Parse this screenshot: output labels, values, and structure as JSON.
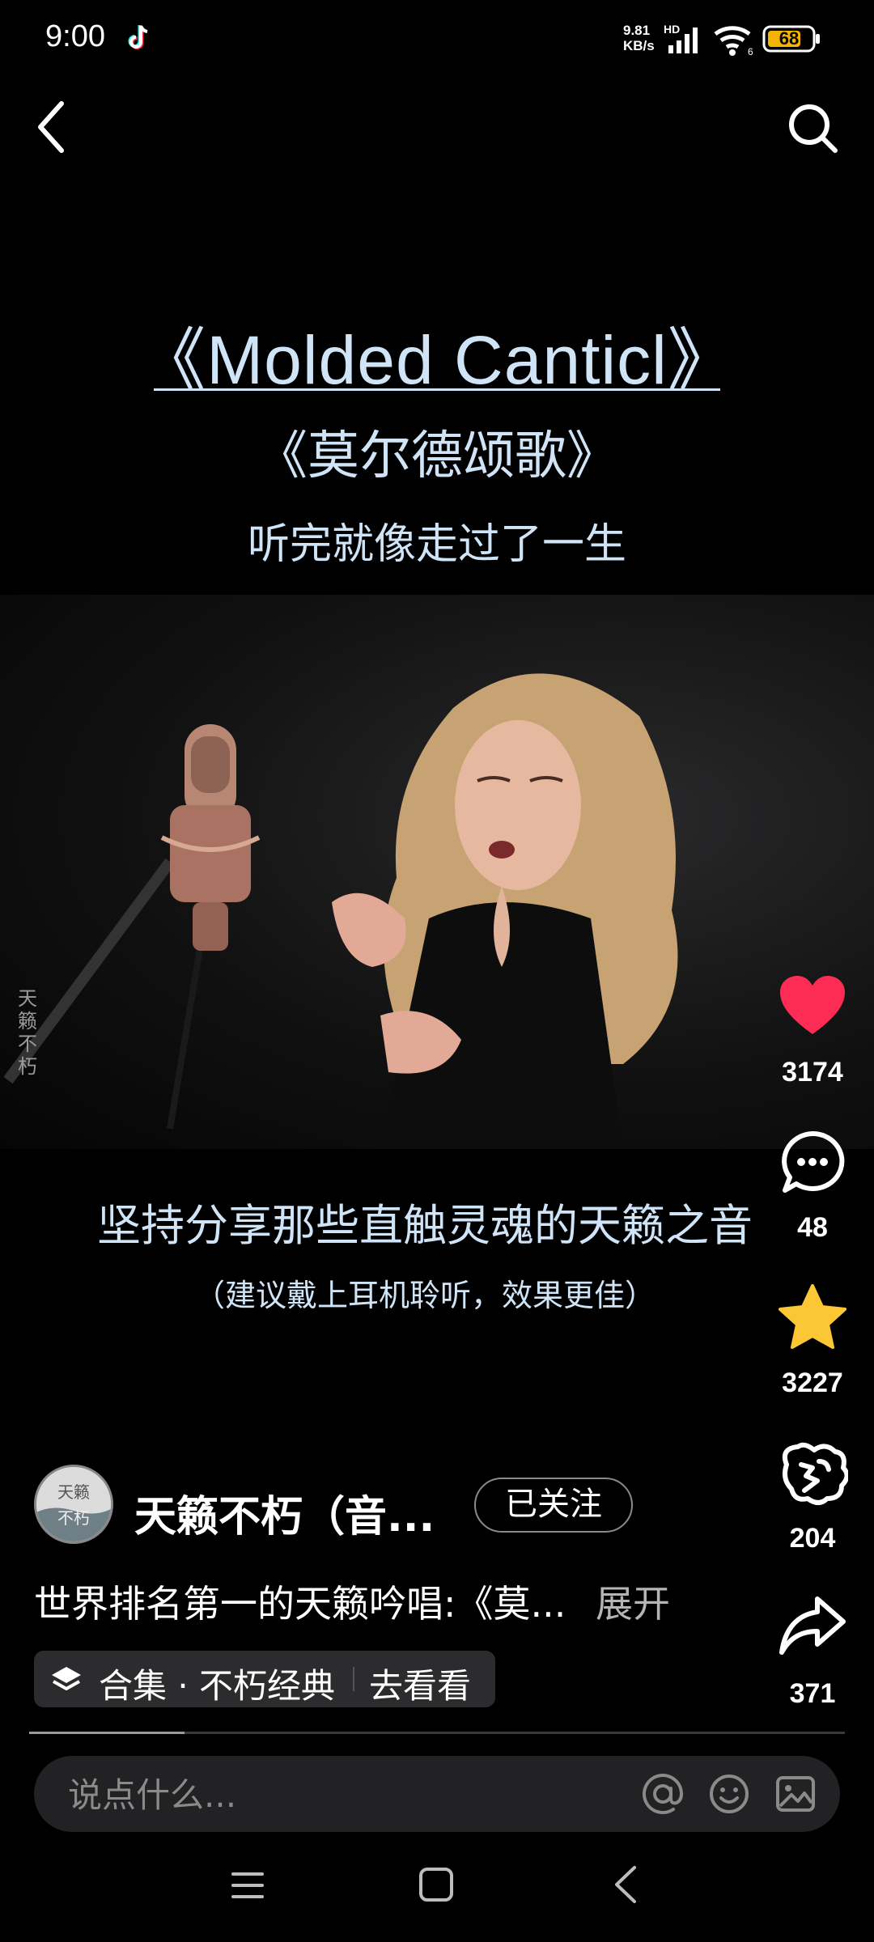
{
  "status_bar": {
    "time": "9:00",
    "net_speed_value": "9.81",
    "net_speed_unit": "KB/s",
    "network_label": "HD",
    "battery": "68"
  },
  "video": {
    "title_en": "《Molded Canticl》",
    "title_cn": "《莫尔德颂歌》",
    "subtitle_cn": "听完就像走过了一生",
    "watermark": "天籁不朽",
    "caption_main": "坚持分享那些直触灵魂的天籁之音",
    "caption_sub": "（建议戴上耳机聆听，效果更佳）"
  },
  "actions": {
    "likes": "3174",
    "comments": "48",
    "favorites": "3227",
    "gifts": "204",
    "shares": "371"
  },
  "author": {
    "avatar_text": "天籁不朽",
    "name": "天籁不朽（音...",
    "follow_label": "已关注"
  },
  "description": {
    "text": "世界排名第一的天籁吟唱:《莫...",
    "expand": "展开"
  },
  "collection": {
    "label": "合集 · 不朽经典",
    "action": "去看看"
  },
  "progress": {
    "fraction": 0.19
  },
  "comment_bar": {
    "placeholder": "说点什么..."
  },
  "colors": {
    "like": "#fd2c55",
    "favorite": "#fcc735",
    "caption": "#cfe4f7"
  }
}
